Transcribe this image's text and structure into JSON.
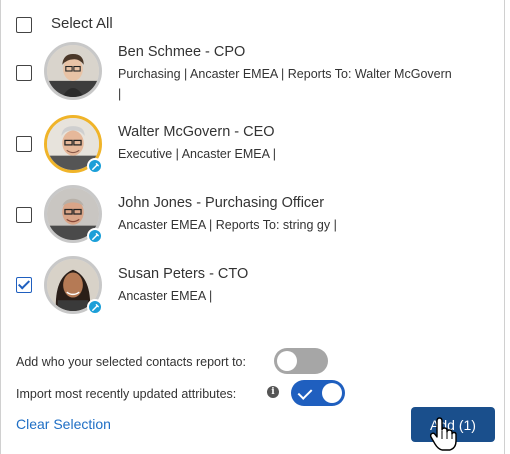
{
  "select_all": {
    "label": "Select All",
    "checked": false
  },
  "contacts": [
    {
      "name": "Ben Schmee   - CPO",
      "detail_line1": "Purchasing | Ancaster EMEA | Reports To: Walter McGovern",
      "detail_line2": "|",
      "checked": false,
      "avatar_border": "gray"
    },
    {
      "name": "Walter McGovern   - CEO",
      "detail_line1": "Executive | Ancaster EMEA |",
      "detail_line2": "",
      "checked": false,
      "avatar_border": "gold"
    },
    {
      "name": "John Jones   - Purchasing Officer",
      "detail_line1": "Ancaster EMEA | Reports To: string gy |",
      "detail_line2": "",
      "checked": false,
      "avatar_border": "gray"
    },
    {
      "name": "Susan Peters   - CTO",
      "detail_line1": "Ancaster EMEA |",
      "detail_line2": "",
      "checked": true,
      "avatar_border": "gray"
    }
  ],
  "settings": {
    "report_to_label": "Add who your selected contacts report to:",
    "report_to_enabled": false,
    "import_attributes_label": "Import most recently updated attributes:",
    "import_attributes_enabled": true,
    "info_icon": "i"
  },
  "footer": {
    "clear_label": "Clear Selection",
    "add_label": "Add (1)"
  },
  "colors": {
    "accent": "#1f5fbf",
    "button": "#1a4f8c",
    "link": "#1f6fc5",
    "badge": "#1c9fd8",
    "avatar_highlight": "#f0b429"
  }
}
